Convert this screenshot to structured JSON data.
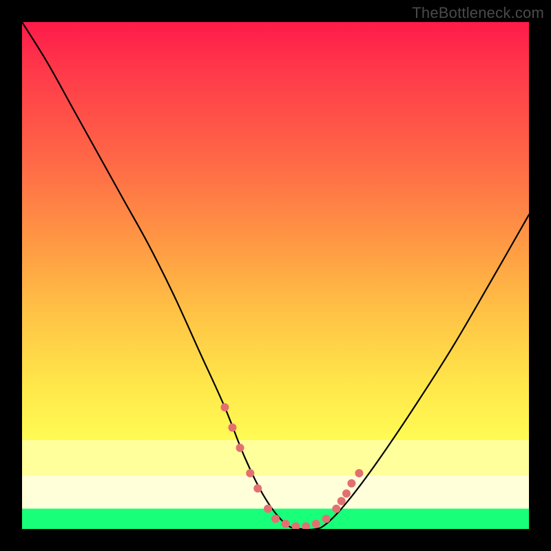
{
  "watermark": "TheBottleneck.com",
  "chart_data": {
    "type": "line",
    "title": "",
    "xlabel": "",
    "ylabel": "",
    "xlim": [
      0,
      100
    ],
    "ylim": [
      0,
      100
    ],
    "series": [
      {
        "name": "bottleneck-curve",
        "x": [
          0,
          5,
          10,
          15,
          20,
          25,
          30,
          35,
          40,
          44,
          48,
          52,
          55,
          58,
          60,
          63,
          67,
          72,
          78,
          85,
          92,
          100
        ],
        "values": [
          100,
          92,
          83,
          74,
          65,
          56,
          46,
          35,
          24,
          14,
          6,
          1,
          0,
          0,
          1,
          4,
          9,
          16,
          25,
          36,
          48,
          62
        ]
      }
    ],
    "markers": {
      "name": "highlight-points",
      "color": "#e37070",
      "x": [
        40,
        41.5,
        43,
        45,
        46.5,
        48.5,
        50,
        52,
        54,
        56,
        58,
        60,
        62,
        63,
        64,
        65,
        66.5
      ],
      "values": [
        24,
        20,
        16,
        11,
        8,
        4,
        2,
        1,
        0.5,
        0.5,
        1,
        2,
        4,
        5.5,
        7,
        9,
        11
      ]
    },
    "bands": [
      {
        "name": "warm-gradient",
        "from_y": 100,
        "to_y": 17.5
      },
      {
        "name": "pale-yellow-1",
        "from_y": 17.5,
        "to_y": 10.5,
        "color": "#ffff9c"
      },
      {
        "name": "pale-yellow-2",
        "from_y": 10.5,
        "to_y": 4,
        "color": "#ffffda"
      },
      {
        "name": "green",
        "from_y": 4,
        "to_y": 0,
        "color": "#18ff7a"
      }
    ]
  }
}
